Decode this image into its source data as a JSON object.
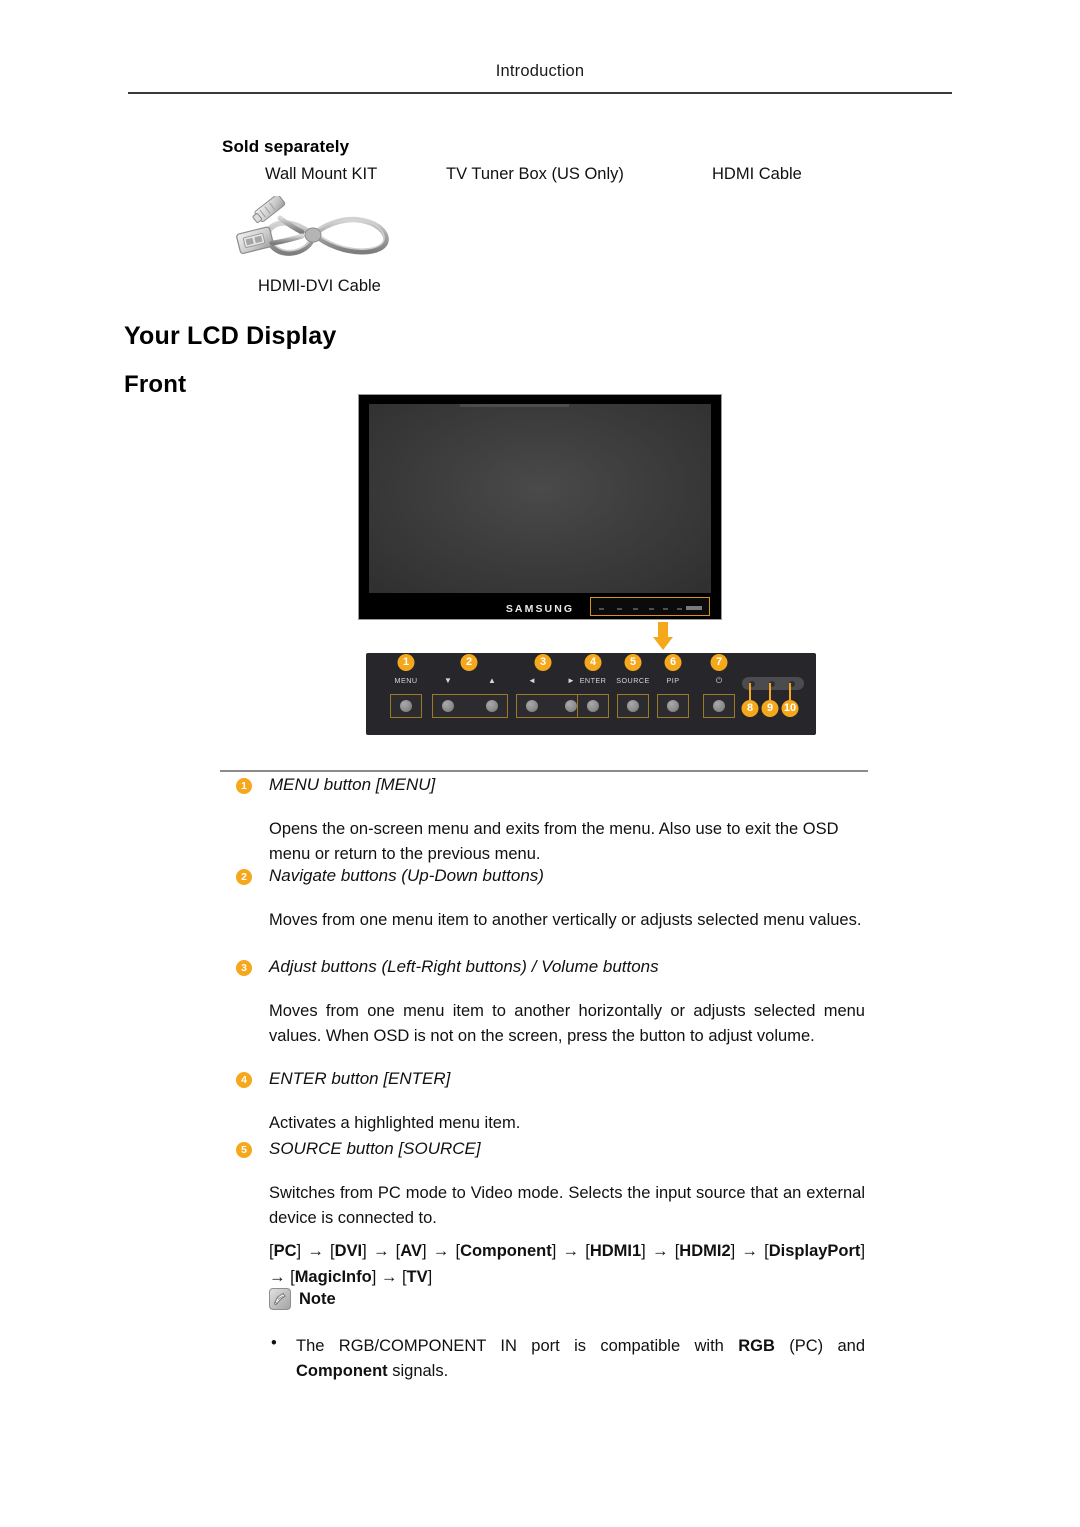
{
  "header": {
    "running_title": "Introduction"
  },
  "sold_separately": {
    "heading": "Sold separately",
    "items": [
      {
        "label": "Wall Mount KIT"
      },
      {
        "label": "TV Tuner Box (US Only)"
      },
      {
        "label": "HDMI Cable"
      }
    ],
    "cable_caption": "HDMI-DVI Cable"
  },
  "sections": {
    "h1": "Your LCD Display",
    "h2": "Front"
  },
  "monitor": {
    "brand_logo": "SAMSUNG"
  },
  "control_panel": {
    "buttons": [
      {
        "label": "MENU",
        "badge": "1"
      },
      {
        "label": "▼",
        "badge": "2"
      },
      {
        "label": "▲",
        "badge": ""
      },
      {
        "label": "◄",
        "badge": "3"
      },
      {
        "label": "►",
        "badge": ""
      },
      {
        "label": "ENTER",
        "badge": "4"
      },
      {
        "label": "SOURCE",
        "badge": "5"
      },
      {
        "label": "PIP",
        "badge": "6"
      },
      {
        "label": "⏻",
        "badge": "7"
      }
    ],
    "sensor_badges": [
      "8",
      "9",
      "10"
    ]
  },
  "descriptions": [
    {
      "num": "1",
      "title": "MENU button [MENU]",
      "body": "Opens the on-screen menu and exits from the menu. Also use to exit the OSD menu or return to the previous menu."
    },
    {
      "num": "2",
      "title": "Navigate buttons (Up-Down buttons)",
      "body": "Moves from one menu item to another vertically or adjusts selected menu values."
    },
    {
      "num": "3",
      "title": "Adjust buttons (Left-Right buttons) / Volume buttons",
      "body": "Moves from one menu item to another horizontally or adjusts selected menu values. When OSD is not on the screen, press the button to adjust volume."
    },
    {
      "num": "4",
      "title": "ENTER button [ENTER]",
      "body": "Activates a highlighted menu item."
    },
    {
      "num": "5",
      "title": "SOURCE button [SOURCE]",
      "body": "Switches from PC mode to Video mode. Selects the input source that an external device is connected to."
    }
  ],
  "source_chain": {
    "items": [
      "PC",
      "DVI",
      "AV",
      "Component",
      "HDMI1",
      "HDMI2",
      "DisplayPort",
      "MagicInfo",
      "TV"
    ],
    "separator": "→"
  },
  "note": {
    "label": "Note",
    "bullet_marker": "•",
    "bullet_text_parts": [
      {
        "text": "The RGB/COMPONENT IN port is compatible with ",
        "bold": false
      },
      {
        "text": "RGB",
        "bold": true
      },
      {
        "text": " (PC) and ",
        "bold": false
      },
      {
        "text": "Component",
        "bold": true
      },
      {
        "text": " signals.",
        "bold": false
      }
    ]
  },
  "colors": {
    "accent_orange": "#f5a81c",
    "rule_dark": "#3a3a3a",
    "rule_light": "#8a8a8a",
    "panel_bg": "#26262b"
  }
}
